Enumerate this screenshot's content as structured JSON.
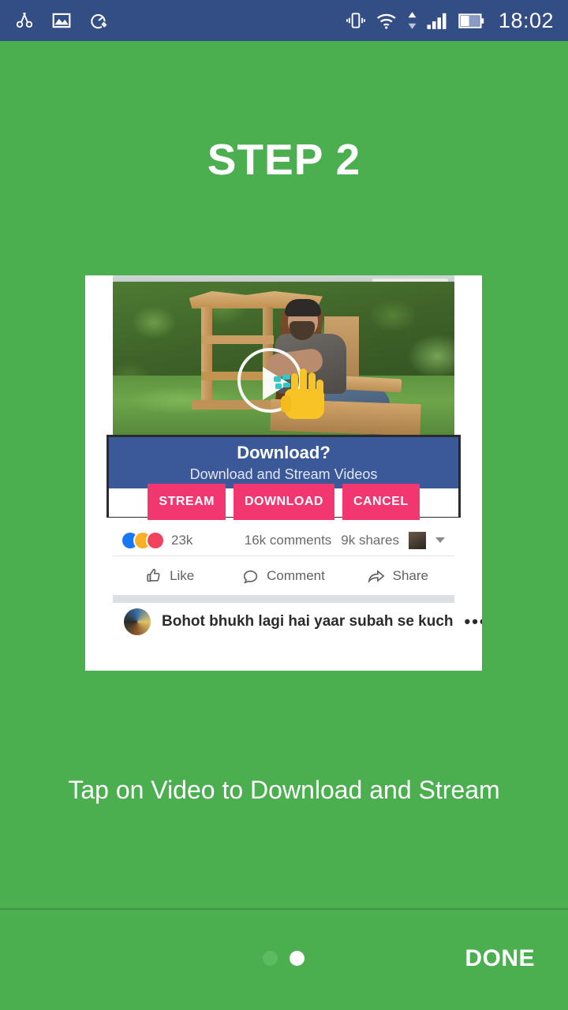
{
  "statusbar": {
    "time": "18:02",
    "left_icons": [
      {
        "name": "scissors-cut-icon"
      },
      {
        "name": "gallery-image-icon"
      },
      {
        "name": "speed-tune-icon"
      }
    ],
    "right_icons": [
      {
        "name": "vibrate-icon"
      },
      {
        "name": "wifi-icon"
      },
      {
        "name": "data-transfer-icon"
      },
      {
        "name": "signal-bars-icon"
      },
      {
        "name": "battery-icon"
      }
    ],
    "background_color": "#334D85"
  },
  "page": {
    "title": "STEP 2",
    "caption": "Tap on Video to Download and Stream",
    "background_color": "#4BAE4F",
    "title_color": "#FFFFFF"
  },
  "screenshot": {
    "video": {
      "alt": "Man sitting on a handmade wooden chair in a garden",
      "play_button": "play-button",
      "tap_hand": "tap-hand-emoji"
    },
    "dialog": {
      "title": "Download?",
      "subtitle": "Download and Stream Videos",
      "header_color": "#3B5998",
      "button_color": "#F23670",
      "buttons": [
        {
          "label": "STREAM"
        },
        {
          "label": "DOWNLOAD"
        },
        {
          "label": "CANCEL"
        }
      ]
    },
    "reactions": {
      "count": "23k",
      "comments": "16k comments",
      "shares": "9k shares",
      "emojis": [
        "like-reaction",
        "haha-reaction",
        "love-reaction"
      ]
    },
    "actions": [
      {
        "label": "Like",
        "icon": "thumbs-up-icon"
      },
      {
        "label": "Comment",
        "icon": "comment-bubble-icon"
      },
      {
        "label": "Share",
        "icon": "share-arrow-icon"
      }
    ],
    "next_post": {
      "text": "Bohot bhukh lagi hai yaar subah se kuch",
      "menu": "•••"
    }
  },
  "bottom": {
    "done_label": "DONE",
    "dots": [
      {
        "state": "inactive"
      },
      {
        "state": "active"
      }
    ]
  }
}
